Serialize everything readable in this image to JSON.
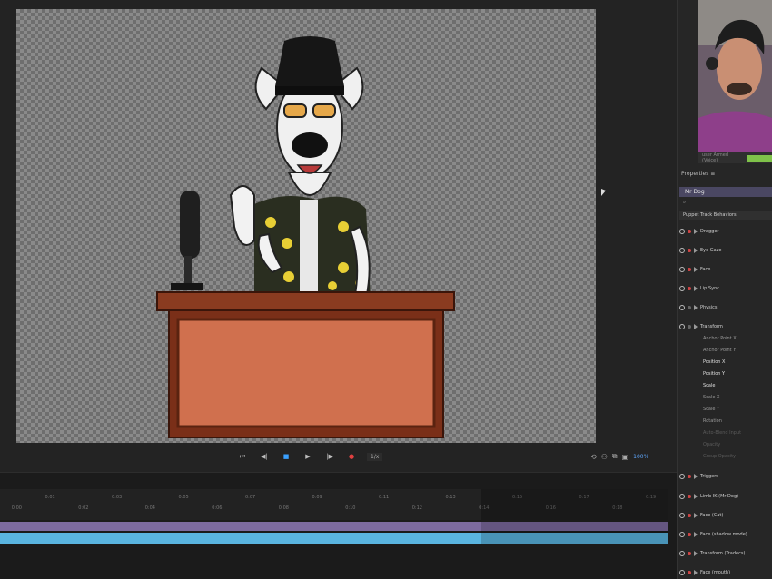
{
  "transport": {
    "buttons": [
      "⏮",
      "◀|",
      "■",
      "▶",
      "|▶",
      "●"
    ],
    "fps_label": "1/x"
  },
  "stage_tools": {
    "zoom_label": "100%"
  },
  "timeline": {
    "ruler_labels": [
      "0:00",
      "0:01",
      "0:02",
      "0:03",
      "0:04",
      "0:05",
      "0:06",
      "0:07",
      "0:08",
      "0:09",
      "0:10",
      "0:11",
      "0:12",
      "0:13",
      "0:14",
      "0:15",
      "0:16",
      "0:17",
      "0:18",
      "0:19"
    ]
  },
  "properties": {
    "tab_label": "Properties ≡",
    "puppet_label": "Mr Dog",
    "search_placeholder": "⌕",
    "group_label": "Puppet Track Behaviors",
    "behaviors": [
      "Dragger",
      "Eye Gaze",
      "Face",
      "Lip Sync",
      "Physics",
      "Transform"
    ],
    "transform_params": [
      "Anchor Point X",
      "Anchor Point Y",
      "Position X",
      "Position Y",
      "Scale",
      "Scale X",
      "Scale Y",
      "Rotation",
      "Auto-Blend Input",
      "Opacity",
      "Group Opacity"
    ],
    "lower_behaviors": [
      "Triggers",
      "Limb IK (Mr Dog)",
      "Face (Cat)",
      "Face (shadow mode)",
      "Transform (Tradecs)",
      "Face (mouth)"
    ]
  },
  "webcam": {
    "name_label": "user Armed (Voice)"
  },
  "colors": {
    "track_purple": "#7c6a9e",
    "track_blue": "#5ab4e0",
    "accent": "#3aa0ff",
    "record": "#e04040"
  }
}
